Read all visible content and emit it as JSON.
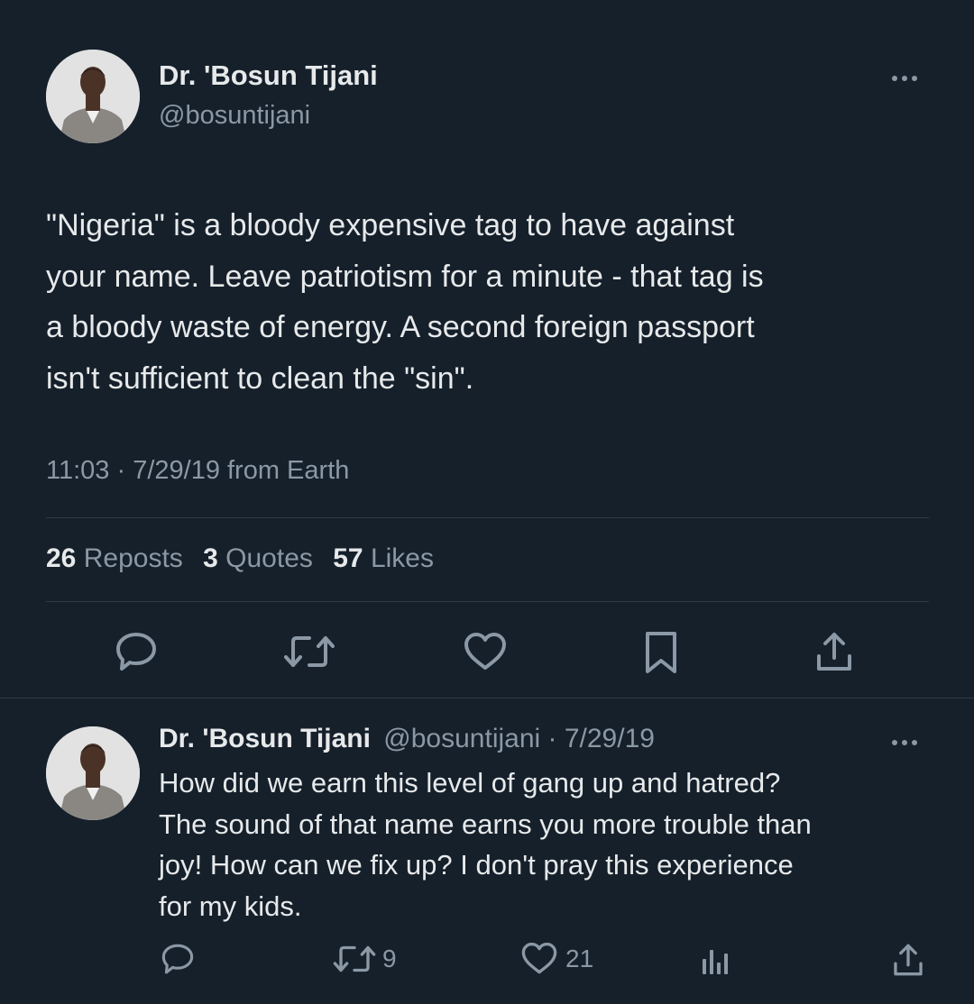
{
  "main_tweet": {
    "author_name": "Dr. 'Bosun Tijani",
    "handle": "@bosuntijani",
    "text_lines": [
      "\"Nigeria\" is a bloody expensive tag to have against",
      "your name. Leave patriotism for a minute - that tag is",
      "a bloody waste of energy. A second foreign passport",
      "isn't sufficient to clean the \"sin\"."
    ],
    "meta": "11:03 · 7/29/19 from Earth",
    "stats": {
      "reposts_count": "26",
      "reposts_label": "Reposts",
      "quotes_count": "3",
      "quotes_label": "Quotes",
      "likes_count": "57",
      "likes_label": "Likes"
    },
    "actions": [
      "reply-icon",
      "repost-icon",
      "like-icon",
      "bookmark-icon",
      "share-icon"
    ]
  },
  "reply_tweet": {
    "author_name": "Dr. 'Bosun Tijani",
    "handle_date": "@bosuntijani · 7/29/19",
    "text_lines": [
      "How did we earn this level of gang up and hatred?",
      "The sound of that name earns you more trouble than",
      "joy! How can we fix up? I don't pray this experience",
      "for my kids."
    ],
    "reposts": "9",
    "likes": "21",
    "actions": [
      "reply-icon",
      "repost-icon",
      "like-icon",
      "views-icon",
      "share-icon"
    ]
  },
  "colors": {
    "background": "#15202b",
    "text": "#e7e9ea",
    "muted": "#8b98a5",
    "divider": "#2f3b47"
  }
}
